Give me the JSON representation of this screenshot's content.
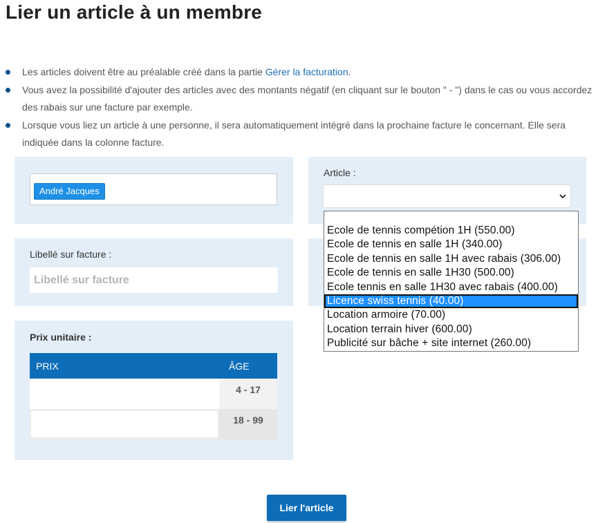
{
  "page": {
    "title": "Lier un article à un membre"
  },
  "info": {
    "item1_text": "Les articles doivent être au préalable créé dans la partie ",
    "item1_link": "Gérer la facturation",
    "item1_end": ".",
    "item2": "Vous avez la possibilité d'ajouter des articles avec des montants négatif (en cliquant sur le bouton \" - \") dans le cas ou vous accordez des rabais sur une facture par exemple.",
    "item3": "Lorsque vous liez un article à une personne, il sera automatiquement intégré dans la prochaine facture le concernant. Elle sera indiquée dans la colonne facture."
  },
  "member": {
    "tag": "André Jacques"
  },
  "article": {
    "label": "Article :",
    "selected_value": "",
    "options": [
      "Ecole de tennis compétion 1H (550.00)",
      "Ecole de tennis en salle 1H (340.00)",
      "Ecole de tennis en salle 1H avec rabais (306.00)",
      "Ecole de tennis en salle 1H30 (500.00)",
      "Ecole tennis en salle 1H30 avec rabais (400.00)",
      "Licence swiss tennis (40.00)",
      "Location armoire (70.00)",
      "Location terrain hiver (600.00)",
      "Publicité sur bâche + site internet (260.00)"
    ],
    "highlighted_index": 5
  },
  "libelle": {
    "label": "Libellé sur facture :",
    "placeholder": "Libellé sur facture",
    "value": ""
  },
  "price": {
    "label": "Prix unitaire :",
    "col_prix": "PRIX",
    "col_age": "ÂGE",
    "rows": [
      {
        "price": "",
        "age": "4 - 17"
      },
      {
        "price": "",
        "age": "18 - 99"
      }
    ]
  },
  "submit": {
    "label": "Lier l'article"
  },
  "colors": {
    "primary": "#0d6db8",
    "panel": "#e3eef8",
    "tag": "#1e90e6",
    "highlight": "#1e90ff"
  }
}
